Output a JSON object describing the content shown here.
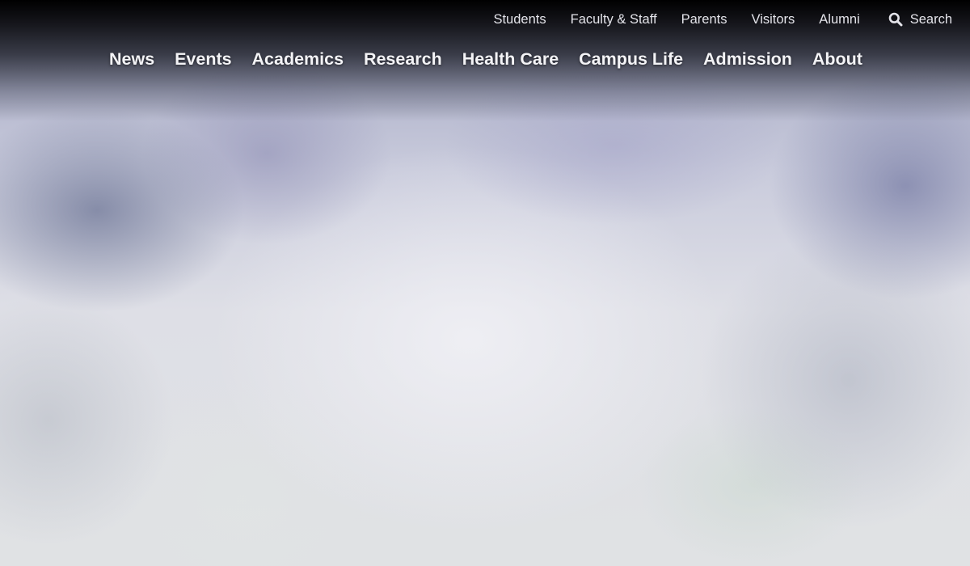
{
  "utility_nav": {
    "items": [
      "Students",
      "Faculty & Staff",
      "Parents",
      "Visitors",
      "Alumni"
    ],
    "search_label": "Search"
  },
  "main_nav": {
    "items": [
      "News",
      "Events",
      "Academics",
      "Research",
      "Health Care",
      "Campus Life",
      "Admission",
      "About"
    ]
  },
  "icons": {
    "search": "search-icon"
  },
  "colors": {
    "nav_text": "#f3f3f6",
    "utility_text": "#e4e4ea",
    "header_shade": "#000000"
  }
}
